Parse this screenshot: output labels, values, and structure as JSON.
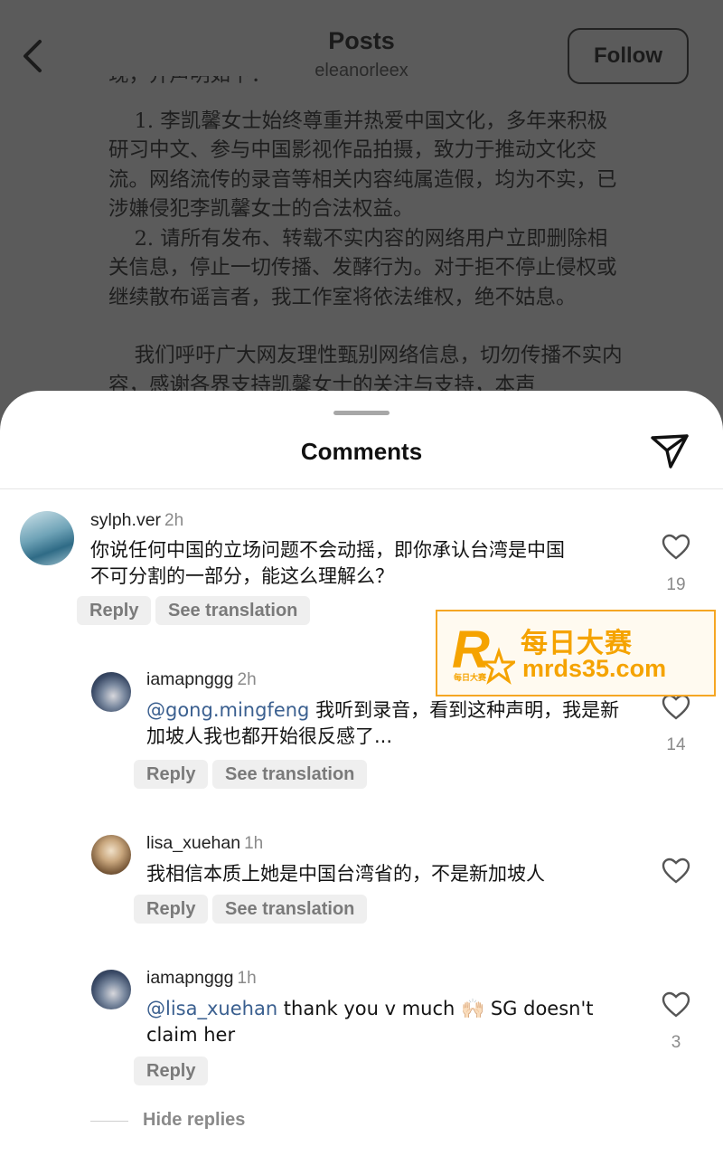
{
  "header": {
    "title": "Posts",
    "username": "eleanorleex",
    "follow_label": "Follow"
  },
  "post_text": {
    "cut_line": "现，并声明如下：",
    "para1": "    1. 李凯馨女士始终尊重并热爱中国文化，多年来积极研习中文、参与中国影视作品拍摄，致力于推动文化交流。网络流传的录音等相关内容纯属造假，均为不实，已涉嫌侵犯李凯馨女士的合法权益。",
    "para2": "    2. 请所有发布、转载不实内容的网络用户立即删除相关信息，停止一切传播、发酵行为。对于拒不停止侵权或继续散布谣言者，我工作室将依法维权，绝不姑息。",
    "para3": "    我们呼吁广大网友理性甄别网络信息，切勿传播不实内容，感谢各界支持凯馨女士的关注与支持，本声"
  },
  "sheet": {
    "title": "Comments"
  },
  "comments": [
    {
      "username": "sylph.ver",
      "time": "2h",
      "text": "你说任何中国的立场问题不会动摇，即你承认台湾是中国不可分割的一部分，能这么理解么？",
      "reply_label": "Reply",
      "translate_label": "See translation",
      "likes": "19"
    },
    {
      "username": "iamapnggg",
      "time": "2h",
      "mention": "@gong.mingfeng",
      "text": " 我听到录音，看到这种声明，我是新加坡人我也都开始很反感了...",
      "reply_label": "Reply",
      "translate_label": "See translation",
      "likes": "14"
    },
    {
      "username": "lisa_xuehan",
      "time": "1h",
      "text": "我相信本质上她是中国台湾省的，不是新加坡人",
      "reply_label": "Reply",
      "translate_label": "See translation"
    },
    {
      "username": "iamapnggg",
      "time": "1h",
      "mention": "@lisa_xuehan",
      "text": " thank you v much 🙌🏻 SG doesn't claim her",
      "reply_label": "Reply",
      "likes": "3"
    }
  ],
  "hide_replies_label": "Hide replies",
  "watermark": {
    "brand_cn": "每日大赛",
    "brand_url": "mrds35.com",
    "logo_small": "每日大赛",
    "accent": "#f5a300"
  }
}
